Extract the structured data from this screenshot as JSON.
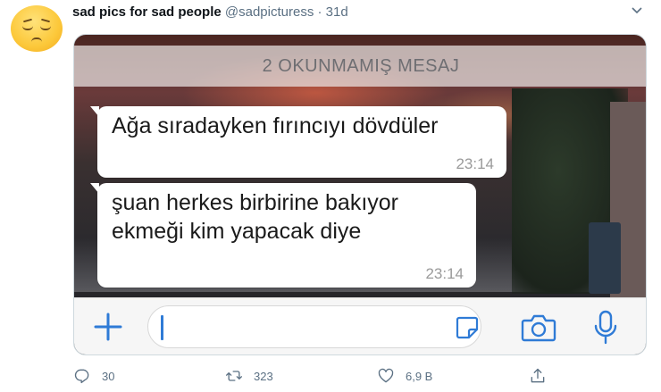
{
  "tweet": {
    "display_name": "sad pics for sad people",
    "handle": "@sadpicturess",
    "separator": "·",
    "age": "31d"
  },
  "media": {
    "unread_banner": "2 OKUNMAMIŞ MESAJ",
    "messages": [
      {
        "text": "Ağa sıradayken fırıncıyı dövdüler",
        "time": "23:14"
      },
      {
        "text_line1": "şuan herkes birbirine bakıyor",
        "text_line2": "ekmeği kim yapacak diye",
        "time": "23:14"
      }
    ],
    "accent_color": "#2f7bd6"
  },
  "actions": {
    "reply_count": "30",
    "retweet_count": "323",
    "like_count": "6,9 B"
  },
  "colors": {
    "name": "#0f1419",
    "secondary": "#5b7083",
    "border": "#cfd9de"
  }
}
